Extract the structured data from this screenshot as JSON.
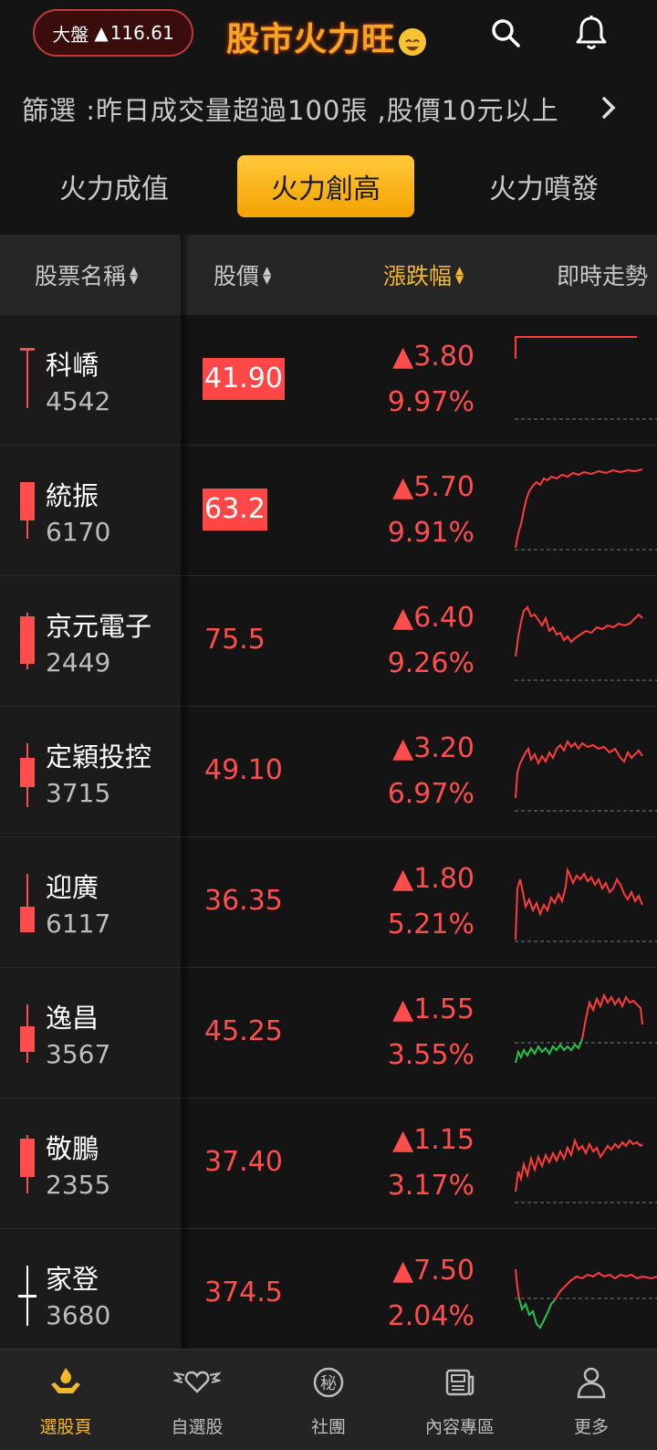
{
  "header": {
    "index_label": "大盤",
    "index_value": "116.61",
    "logo_text": "股市火力旺"
  },
  "filter": {
    "text": "篩選 :昨日成交量超過100張 ,股價10元以上"
  },
  "tabs": [
    {
      "label": "火力成值",
      "active": false
    },
    {
      "label": "火力創高",
      "active": true
    },
    {
      "label": "火力噴發",
      "active": false
    }
  ],
  "columns": {
    "name": "股票名稱",
    "price": "股價",
    "change": "漲跌幅",
    "trend": "即時走勢"
  },
  "colors": {
    "up": "#ff4d4d",
    "down": "#27c24c",
    "accent": "#f5b72a"
  },
  "rows": [
    {
      "name": "科嶠",
      "code": "4542",
      "price": "41.90",
      "price_highlight": true,
      "change": "▲3.80",
      "pct": "9.97%"
    },
    {
      "name": "統振",
      "code": "6170",
      "price": "63.2",
      "price_highlight": true,
      "change": "▲5.70",
      "pct": "9.91%"
    },
    {
      "name": "京元電子",
      "code": "2449",
      "price": "75.5",
      "price_highlight": false,
      "change": "▲6.40",
      "pct": "9.26%"
    },
    {
      "name": "定穎投控",
      "code": "3715",
      "price": "49.10",
      "price_highlight": false,
      "change": "▲3.20",
      "pct": "6.97%"
    },
    {
      "name": "迎廣",
      "code": "6117",
      "price": "36.35",
      "price_highlight": false,
      "change": "▲1.80",
      "pct": "5.21%"
    },
    {
      "name": "逸昌",
      "code": "3567",
      "price": "45.25",
      "price_highlight": false,
      "change": "▲1.55",
      "pct": "3.55%"
    },
    {
      "name": "敬鵬",
      "code": "2355",
      "price": "37.40",
      "price_highlight": false,
      "change": "▲1.15",
      "pct": "3.17%"
    },
    {
      "name": "家登",
      "code": "3680",
      "price": "374.5",
      "price_highlight": false,
      "change": "▲7.50",
      "pct": "2.04%"
    }
  ],
  "bottom_nav": [
    {
      "label": "選股頁",
      "icon": "hand-fire-icon",
      "active": true
    },
    {
      "label": "自選股",
      "icon": "heart-wings-icon",
      "active": false
    },
    {
      "label": "社團",
      "icon": "secret-badge-icon",
      "active": false
    },
    {
      "label": "內容專區",
      "icon": "newspaper-icon",
      "active": false
    },
    {
      "label": "更多",
      "icon": "person-icon",
      "active": false
    }
  ]
}
